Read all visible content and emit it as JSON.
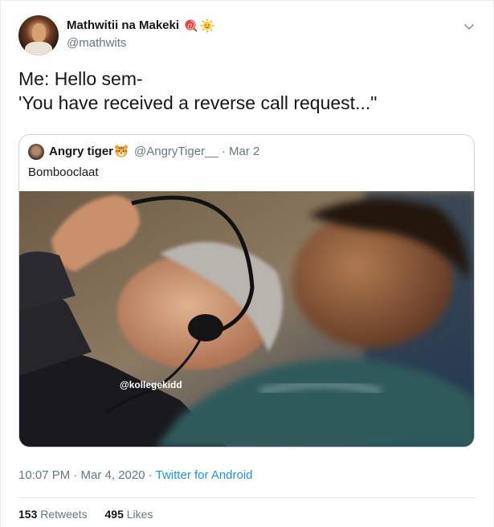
{
  "tweet": {
    "author": {
      "display_name": "Mathwitii na Makeki",
      "handle": "@mathwits",
      "name_emojis": [
        "lollipop-icon",
        "sun-face-icon"
      ]
    },
    "text_lines": [
      "Me: Hello sem-",
      "'You have received a reverse call request...\""
    ],
    "quoted": {
      "display_name": "Angry tiger",
      "name_emoji": "tiger-face-icon",
      "handle_and_date": "@AngryTiger__ · Mar 2",
      "text": "Bombooclaat",
      "image_watermark": "@kollegekidd"
    },
    "meta": {
      "time_date": "10:07 PM · Mar 4, 2020 · ",
      "source": "Twitter for Android"
    },
    "stats": {
      "retweets_count": "153",
      "retweets_label": "Retweets",
      "likes_count": "495",
      "likes_label": "Likes"
    }
  },
  "colors": {
    "text": "#14171a",
    "secondary": "#657786",
    "link": "#1b95e0",
    "border": "#ccd6dd"
  }
}
